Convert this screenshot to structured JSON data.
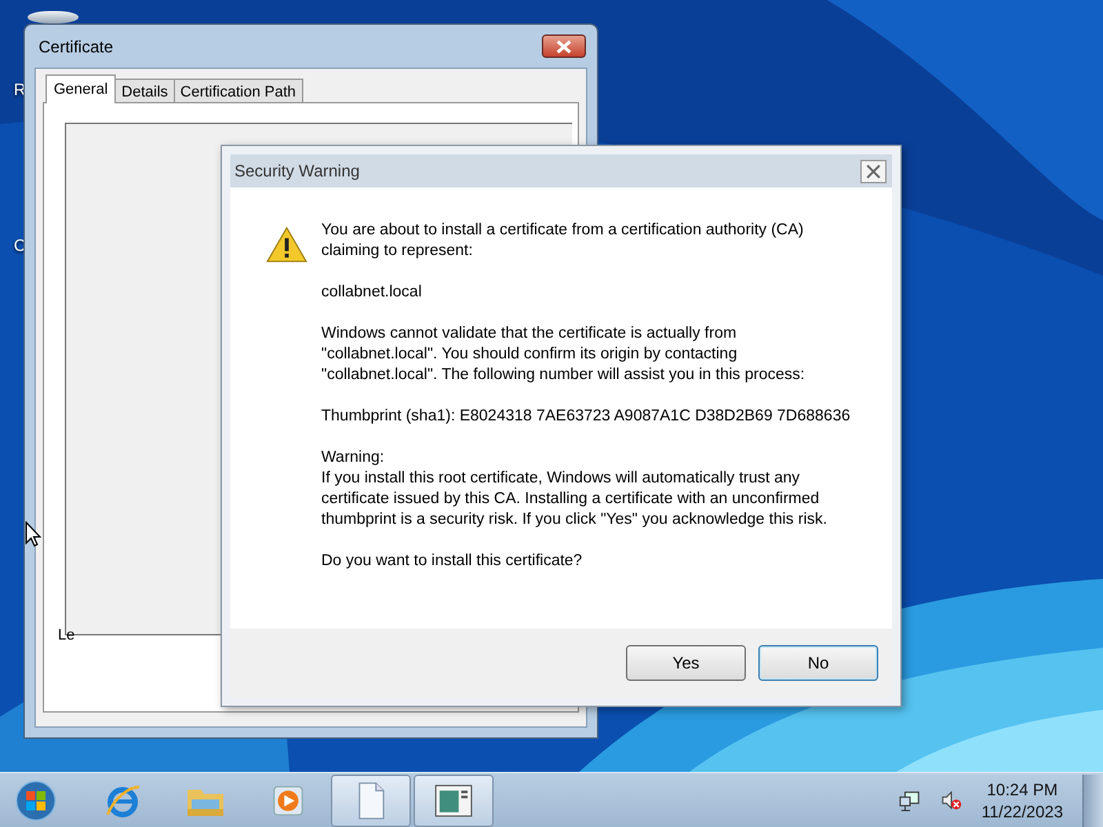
{
  "desktop": {
    "icon_labels": [
      "R",
      "C"
    ]
  },
  "certificate_window": {
    "title": "Certificate",
    "tabs": [
      {
        "label": "General",
        "selected": true
      },
      {
        "label": "Details",
        "selected": false
      },
      {
        "label": "Certification Path",
        "selected": false
      }
    ],
    "partial_label": "Le"
  },
  "security_warning": {
    "title": "Security Warning",
    "paragraphs": [
      "You are about to install a certificate from a certification authority (CA) claiming to represent:",
      "collabnet.local",
      "Windows cannot validate that the certificate is actually from \"collabnet.local\". You should confirm its origin by contacting \"collabnet.local\". The following number will assist you in this process:",
      "Thumbprint (sha1): E8024318 7AE63723 A9087A1C D38D2B69 7D688636",
      "Warning:\nIf you install this root certificate, Windows will automatically trust any certificate issued by this CA. Installing a certificate with an unconfirmed thumbprint is a security risk. If you click \"Yes\" you acknowledge this risk.",
      "Do you want to install this certificate?"
    ],
    "buttons": [
      {
        "label": "Yes",
        "selected": false
      },
      {
        "label": "No",
        "selected": true
      }
    ]
  },
  "taskbar": {
    "pinned": [
      {
        "kind": "ie",
        "active": false
      },
      {
        "kind": "folder",
        "active": false
      },
      {
        "kind": "media",
        "active": false
      },
      {
        "kind": "document",
        "active": true
      },
      {
        "kind": "certificate",
        "active": true
      }
    ],
    "clock": {
      "time": "10:24 PM",
      "date": "11/22/2023"
    }
  }
}
